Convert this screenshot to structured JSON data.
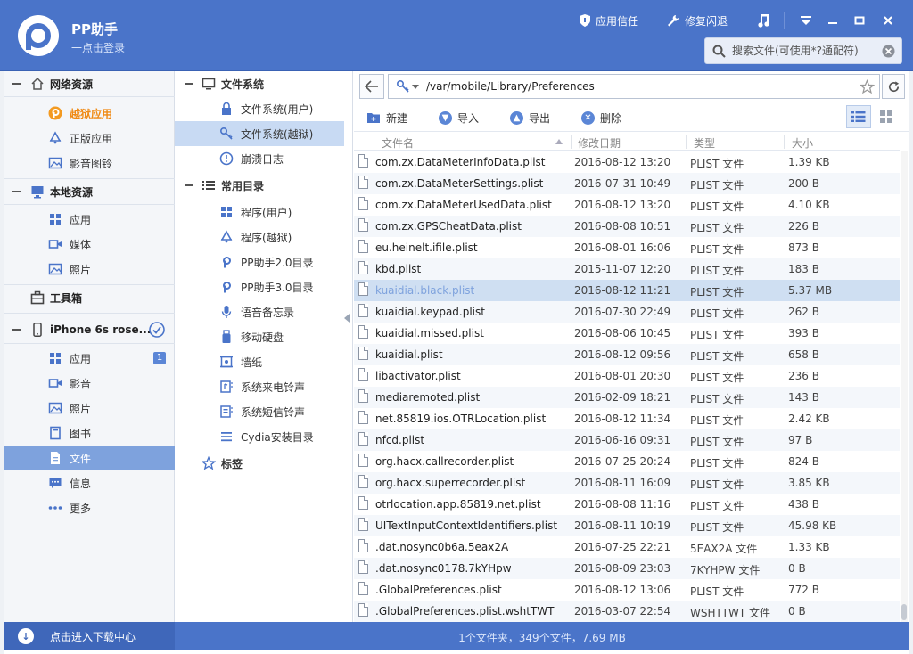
{
  "header": {
    "app_name": "PP助手",
    "login_hint": "一点击登录",
    "trust_label": "应用信任",
    "repair_label": "修复闪退",
    "search_placeholder": "搜索文件(可使用*?通配符)"
  },
  "sidebar": {
    "sections": [
      {
        "title": "网络资源",
        "items": [
          "越狱应用",
          "正版应用",
          "影音图铃"
        ]
      },
      {
        "title": "本地资源",
        "items": [
          "应用",
          "媒体",
          "照片"
        ]
      },
      {
        "title": "工具箱"
      },
      {
        "title": "iPhone 6s rose...",
        "items": [
          "应用",
          "影音",
          "照片",
          "图书",
          "文件",
          "信息",
          "更多"
        ],
        "app_badge": "1"
      }
    ]
  },
  "middle": {
    "filesystem": {
      "title": "文件系统",
      "items": [
        "文件系统(用户)",
        "文件系统(越狱)",
        "崩溃日志"
      ]
    },
    "common": {
      "title": "常用目录",
      "items": [
        "程序(用户)",
        "程序(越狱)",
        "PP助手2.0目录",
        "PP助手3.0目录",
        "语音备忘录",
        "移动硬盘",
        "墙纸",
        "系统来电铃声",
        "系统短信铃声",
        "Cydia安装目录"
      ]
    },
    "tags": {
      "title": "标签"
    }
  },
  "address": {
    "path": "/var/mobile/Library/Preferences"
  },
  "toolbar": {
    "new": "新建",
    "import": "导入",
    "export": "导出",
    "delete": "删除"
  },
  "table": {
    "headers": [
      "文件名",
      "修改日期",
      "类型",
      "大小"
    ],
    "rows": [
      [
        "com.zx.DataMeterInfoData.plist",
        "2016-08-12 13:20",
        "PLIST 文件",
        "1.39 KB"
      ],
      [
        "com.zx.DataMeterSettings.plist",
        "2016-07-31 10:49",
        "PLIST 文件",
        "200 B"
      ],
      [
        "com.zx.DataMeterUsedData.plist",
        "2016-08-12 13:20",
        "PLIST 文件",
        "4.10 KB"
      ],
      [
        "com.zx.GPSCheatData.plist",
        "2016-08-08 10:51",
        "PLIST 文件",
        "226 B"
      ],
      [
        "eu.heinelt.ifile.plist",
        "2016-08-01 16:06",
        "PLIST 文件",
        "873 B"
      ],
      [
        "kbd.plist",
        "2015-11-07 12:20",
        "PLIST 文件",
        "183 B"
      ],
      [
        "kuaidial.black.plist",
        "2016-08-12 11:21",
        "PLIST 文件",
        "5.37 MB"
      ],
      [
        "kuaidial.keypad.plist",
        "2016-07-30 22:49",
        "PLIST 文件",
        "262 B"
      ],
      [
        "kuaidial.missed.plist",
        "2016-08-06 10:45",
        "PLIST 文件",
        "393 B"
      ],
      [
        "kuaidial.plist",
        "2016-08-12 09:56",
        "PLIST 文件",
        "658 B"
      ],
      [
        "libactivator.plist",
        "2016-08-01 20:30",
        "PLIST 文件",
        "236 B"
      ],
      [
        "mediaremoted.plist",
        "2016-02-09 18:21",
        "PLIST 文件",
        "143 B"
      ],
      [
        "net.85819.ios.OTRLocation.plist",
        "2016-08-12 11:34",
        "PLIST 文件",
        "2.42 KB"
      ],
      [
        "nfcd.plist",
        "2016-06-16 09:31",
        "PLIST 文件",
        "97 B"
      ],
      [
        "org.hacx.callrecorder.plist",
        "2016-07-25 20:24",
        "PLIST 文件",
        "824 B"
      ],
      [
        "org.hacx.superrecorder.plist",
        "2016-08-11 16:09",
        "PLIST 文件",
        "3.85 KB"
      ],
      [
        "otrlocation.app.85819.net.plist",
        "2016-08-08 11:16",
        "PLIST 文件",
        "438 B"
      ],
      [
        "UITextInputContextIdentifiers.plist",
        "2016-08-11 10:19",
        "PLIST 文件",
        "45.98 KB"
      ],
      [
        ".dat.nosync0b6a.5eax2A",
        "2016-07-25 22:21",
        "5EAX2A 文件",
        "1.33 KB"
      ],
      [
        ".dat.nosync0178.7kYHpw",
        "2016-08-09 23:03",
        "7KYHPW 文件",
        "0 B"
      ],
      [
        ".GlobalPreferences.plist",
        "2016-08-12 13:06",
        "PLIST 文件",
        "772 B"
      ],
      [
        ".GlobalPreferences.plist.wshtTWT",
        "2016-03-07 22:54",
        "WSHTTWT 文件",
        "0 B"
      ]
    ]
  },
  "footer": {
    "download_center": "点击进入下载中心",
    "status": "1个文件夹，349个文件，7.69 MB"
  }
}
